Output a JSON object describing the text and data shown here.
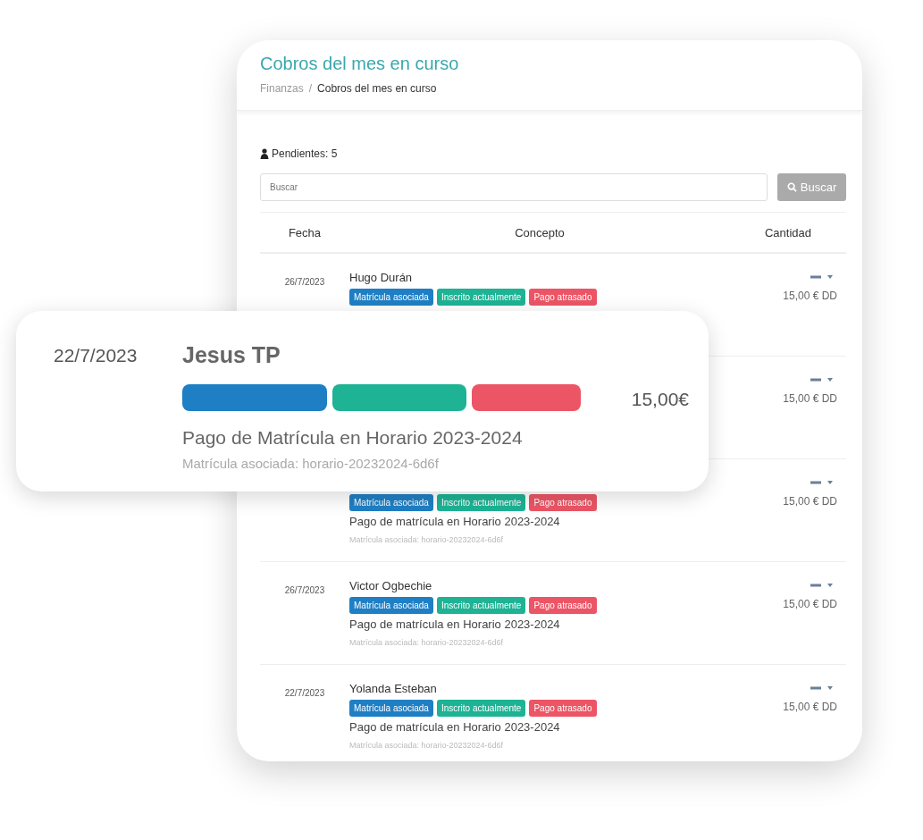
{
  "page": {
    "title": "Cobros del mes en curso",
    "breadcrumb_separator": "/",
    "breadcrumb": [
      {
        "label": "Finanzas"
      },
      {
        "label": "Cobros del mes en curso"
      }
    ]
  },
  "pending": "Pendientes: 5",
  "search": {
    "placeholder": "Buscar",
    "button": "Buscar"
  },
  "table": {
    "columns": [
      "Fecha",
      "Concepto",
      "Cantidad"
    ],
    "rows": [
      {
        "date": "26/7/2023",
        "name": "Hugo Durán",
        "tags": [
          {
            "label": "Matrícula asociada",
            "color": "#1f7fc4"
          },
          {
            "label": "Inscrito actualmente",
            "color": "#1db394"
          },
          {
            "label": "Pago atrasado",
            "color": "#ec5565"
          }
        ],
        "amount": "15,00 € DD"
      },
      {
        "amount": "15,00 € DD"
      },
      {
        "tags": [
          {
            "label": "Matrícula asociada",
            "color": "#1f7fc4"
          },
          {
            "label": "Inscrito actualmente",
            "color": "#1db394"
          },
          {
            "label": "Pago atrasado",
            "color": "#ec5565"
          }
        ],
        "concept": "Pago de matrícula en Horario 2023-2024",
        "detail": "Matrícula asociada: horario-20232024-6d6f",
        "amount": "15,00 € DD"
      },
      {
        "date": "26/7/2023",
        "name": "Victor Ogbechie",
        "tags": [
          {
            "label": "Matrícula asociada",
            "color": "#1f7fc4"
          },
          {
            "label": "Inscrito actualmente",
            "color": "#1db394"
          },
          {
            "label": "Pago atrasado",
            "color": "#ec5565"
          }
        ],
        "concept": "Pago de matrícula en Horario 2023-2024",
        "detail": "Matrícula asociada: horario-20232024-6d6f",
        "amount": "15,00 € DD"
      },
      {
        "date": "22/7/2023",
        "name": "Yolanda Esteban",
        "tags": [
          {
            "label": "Matrícula asociada",
            "color": "#1f7fc4"
          },
          {
            "label": "Inscrito actualmente",
            "color": "#1db394"
          },
          {
            "label": "Pago atrasado",
            "color": "#ec5565"
          }
        ],
        "concept": "Pago de matrícula en Horario 2023-2024",
        "detail": "Matrícula asociada: horario-20232024-6d6f",
        "amount": "15,00 € DD"
      }
    ]
  },
  "highlight": {
    "date": "22/7/2023",
    "name": "Jesus TP",
    "tags": [
      {
        "color": "#1e7fc5"
      },
      {
        "color": "#1db394"
      },
      {
        "color": "#ec5565"
      }
    ],
    "amount": "15,00€",
    "concept": "Pago de Matrícula en Horario 2023-2024",
    "detail": "Matrícula asociada: horario-20232024-6d6f"
  }
}
